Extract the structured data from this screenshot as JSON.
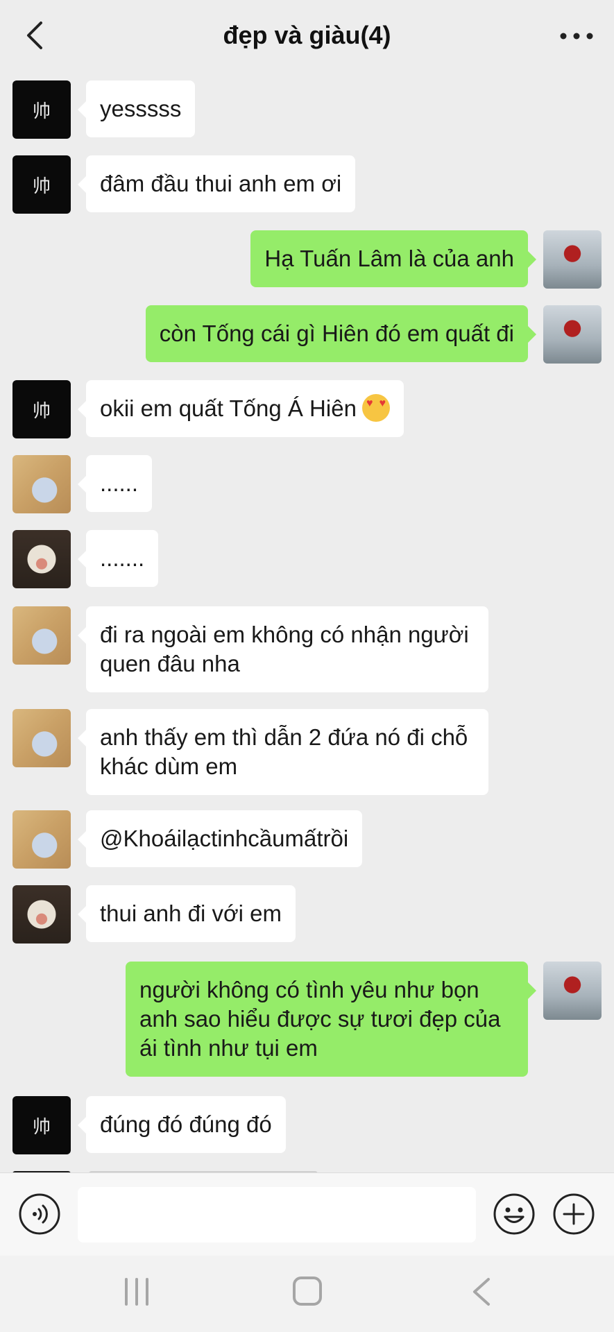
{
  "header": {
    "title": "đẹp và giàu(4)",
    "back_icon": "chevron-left-icon",
    "more_icon": "more-horizontal-icon"
  },
  "avatars": {
    "black_avatar_glyph": "帅"
  },
  "messages": [
    {
      "side": "left",
      "avatar": "black",
      "text": "yesssss"
    },
    {
      "side": "left",
      "avatar": "black",
      "text": "đâm đầu thui anh em ơi"
    },
    {
      "side": "right",
      "avatar": "robot",
      "text": "Hạ Tuấn Lâm là của anh"
    },
    {
      "side": "right",
      "avatar": "robot",
      "text": "còn Tống cái gì Hiên đó em quất đi"
    },
    {
      "side": "left",
      "avatar": "black",
      "text": "okii em quất Tống Á Hiên",
      "emoji": "heart-eyes-emoji"
    },
    {
      "side": "left",
      "avatar": "hand",
      "text": "......"
    },
    {
      "side": "left",
      "avatar": "dog",
      "text": "......."
    },
    {
      "side": "left",
      "avatar": "hand",
      "text": "đi ra ngoài em không có nhận người quen đâu nha"
    },
    {
      "side": "left",
      "avatar": "hand",
      "text": "anh thấy em thì dẫn 2 đứa nó đi chỗ khác dùm em"
    },
    {
      "side": "left",
      "avatar": "hand",
      "text": "@Khoáilạctinhcầumấtrồi"
    },
    {
      "side": "left",
      "avatar": "dog",
      "text": "thui anh đi với em"
    },
    {
      "side": "right",
      "avatar": "robot",
      "text": "người không có tình yêu như bọn anh sao hiểu được sự tươi đẹp của ái tình như tụi em"
    },
    {
      "side": "left",
      "avatar": "black",
      "text": "đúng đó đúng đó"
    }
  ],
  "input_bar": {
    "voice_icon": "voice-icon",
    "text_value": "",
    "emoji_icon": "smiley-icon",
    "plus_icon": "plus-circle-icon"
  },
  "nav_bar": {
    "recent_icon": "recent-apps-icon",
    "home_icon": "home-icon",
    "back_icon": "back-icon"
  },
  "colors": {
    "background": "#ededed",
    "bubble_self": "#95ec69",
    "bubble_other": "#ffffff"
  }
}
